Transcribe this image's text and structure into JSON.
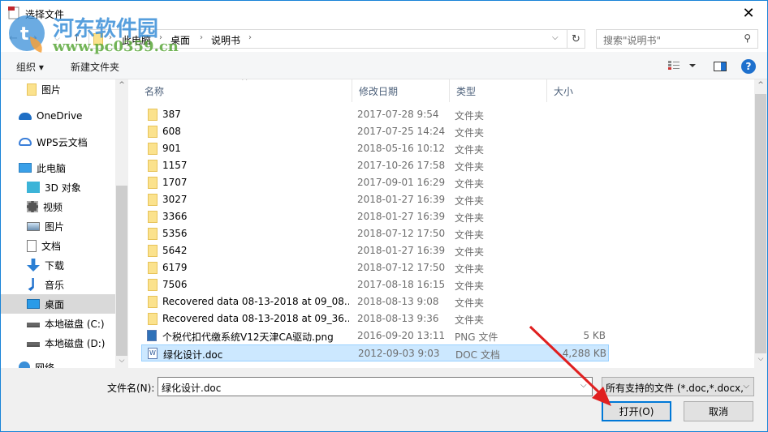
{
  "window": {
    "title": "选择文件",
    "close_label": "✕"
  },
  "watermark": {
    "title": "河东软件园",
    "url": "www.pc0359.cn"
  },
  "address": {
    "crumbs": [
      "此电脑",
      "桌面",
      "说明书"
    ],
    "search_placeholder": "搜索\"说明书\""
  },
  "toolbar": {
    "organize_label": "组织 ▾",
    "new_folder_label": "新建文件夹",
    "help_label": "?"
  },
  "sidebar": {
    "items": [
      {
        "label": "图片",
        "icon": "folder-icon"
      },
      {
        "label": "OneDrive",
        "icon": "onedrive-cloud-icon"
      },
      {
        "label": "WPS云文档",
        "icon": "wps-cloud-icon"
      },
      {
        "label": "此电脑",
        "icon": "computer-icon"
      },
      {
        "label": "3D 对象",
        "icon": "3d-objects-icon"
      },
      {
        "label": "视频",
        "icon": "video-icon"
      },
      {
        "label": "图片",
        "icon": "pictures-icon"
      },
      {
        "label": "文档",
        "icon": "documents-icon"
      },
      {
        "label": "下载",
        "icon": "download-icon"
      },
      {
        "label": "音乐",
        "icon": "music-icon"
      },
      {
        "label": "桌面",
        "icon": "desktop-icon",
        "selected": true
      },
      {
        "label": "本地磁盘 (C:)",
        "icon": "drive-c-icon"
      },
      {
        "label": "本地磁盘 (D:)",
        "icon": "drive-d-icon"
      },
      {
        "label": "网络",
        "icon": "network-icon"
      }
    ]
  },
  "filelist": {
    "columns": [
      "名称",
      "修改日期",
      "类型",
      "大小"
    ],
    "rows": [
      {
        "name": "387",
        "date": "2017-07-28 9:54",
        "type": "文件夹",
        "size": "",
        "kind": "folder"
      },
      {
        "name": "608",
        "date": "2017-07-25 14:24",
        "type": "文件夹",
        "size": "",
        "kind": "folder"
      },
      {
        "name": "901",
        "date": "2018-05-16 10:12",
        "type": "文件夹",
        "size": "",
        "kind": "folder"
      },
      {
        "name": "1157",
        "date": "2017-10-26 17:58",
        "type": "文件夹",
        "size": "",
        "kind": "folder"
      },
      {
        "name": "1707",
        "date": "2017-09-01 16:29",
        "type": "文件夹",
        "size": "",
        "kind": "folder"
      },
      {
        "name": "3027",
        "date": "2018-01-27 16:39",
        "type": "文件夹",
        "size": "",
        "kind": "folder"
      },
      {
        "name": "3366",
        "date": "2018-01-27 16:39",
        "type": "文件夹",
        "size": "",
        "kind": "folder"
      },
      {
        "name": "5356",
        "date": "2018-07-12 17:50",
        "type": "文件夹",
        "size": "",
        "kind": "folder"
      },
      {
        "name": "5642",
        "date": "2018-01-27 16:39",
        "type": "文件夹",
        "size": "",
        "kind": "folder"
      },
      {
        "name": "6179",
        "date": "2018-07-12 17:50",
        "type": "文件夹",
        "size": "",
        "kind": "folder"
      },
      {
        "name": "7506",
        "date": "2017-08-18 16:15",
        "type": "文件夹",
        "size": "",
        "kind": "folder"
      },
      {
        "name": "Recovered data 08-13-2018 at 09_08...",
        "date": "2018-08-13 9:08",
        "type": "文件夹",
        "size": "",
        "kind": "folder"
      },
      {
        "name": "Recovered data 08-13-2018 at 09_36...",
        "date": "2018-08-13 9:36",
        "type": "文件夹",
        "size": "",
        "kind": "folder"
      },
      {
        "name": "个税代扣代缴系统V12天津CA驱动.png",
        "date": "2016-09-20 13:11",
        "type": "PNG 文件",
        "size": "5 KB",
        "kind": "png"
      },
      {
        "name": "绿化设计.doc",
        "date": "2012-09-03 9:03",
        "type": "DOC 文档",
        "size": "4,288 KB",
        "kind": "doc",
        "selected": true
      }
    ]
  },
  "bottom": {
    "filename_label": "文件名(N):",
    "filename_value": "绿化设计.doc",
    "filter_value": "所有支持的文件 (*.doc,*.docx,",
    "open_label": "打开(O)",
    "cancel_label": "取消"
  },
  "colors": {
    "accent": "#0078d7",
    "selection": "#cce8ff",
    "annotation_arrow": "#e02020"
  }
}
